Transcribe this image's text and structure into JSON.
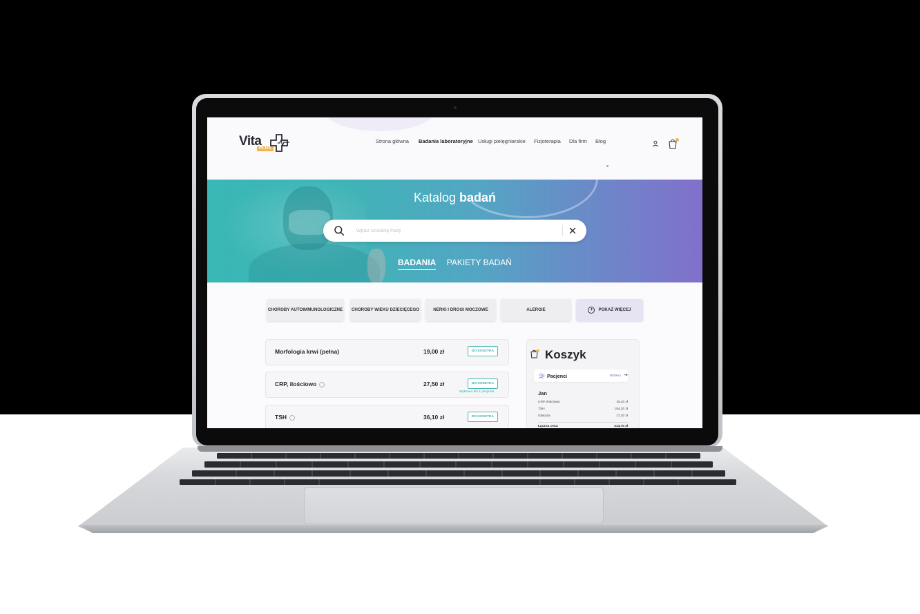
{
  "colors": {
    "accent_teal": "#39b8b5",
    "accent_purple": "#8270cb",
    "brand_yellow": "#f1b64a",
    "text_dark": "#25272e"
  },
  "logo": {
    "text": "Vita",
    "badge": "PLUS",
    "icon": "medical-cross-pulse-icon"
  },
  "nav": {
    "items": [
      {
        "label": "Strona główna"
      },
      {
        "label": "Badania laboratoryjne",
        "active": true
      },
      {
        "label": "Usługi pielęgniarskie"
      },
      {
        "label": "Fizjoterapia"
      },
      {
        "label": "Dla firm"
      },
      {
        "label": "Blog"
      }
    ],
    "icons": [
      "user-icon",
      "cart-icon"
    ]
  },
  "hero": {
    "title_light": "Katalog",
    "title_bold": "badań",
    "search": {
      "placeholder": "Wpisz szukaną frazę",
      "value": ""
    },
    "tabs": [
      {
        "label": "BADANIA",
        "active": true
      },
      {
        "label": "PAKIETY BADAŃ",
        "active": false
      }
    ]
  },
  "categories": [
    {
      "label": "CHOROBY AUTOIMMUNOLOGICZNE"
    },
    {
      "label": "CHOROBY WIEKU DZIECIĘCEGO"
    },
    {
      "label": "NERKI I DROGI MOCZOWE"
    },
    {
      "label": "ALERGIE"
    },
    {
      "label": "POKAŻ WIĘCEJ",
      "icon": "plus-circle-icon"
    }
  ],
  "tests": [
    {
      "name": "Morfologia krwi (pełna)",
      "price": "19,00 zł",
      "button": "DO KOSZYKA",
      "note": ""
    },
    {
      "name": "CRP, ilościowo",
      "price": "27,50 zł",
      "button": "DO KOSZYKA",
      "note": "Wybrano dla 1 pacjenta"
    },
    {
      "name": "TSH",
      "price": "36,10 zł",
      "button": "DO KOSZYKA",
      "note": ""
    }
  ],
  "cart": {
    "title": "Koszyk",
    "patients_label": "Pacjenci",
    "add_label": "DODAJ",
    "patient_name": "Jan",
    "rows": [
      {
        "name": "CRP, ilościowo",
        "price": "15,20 zł"
      },
      {
        "name": "TSH",
        "price": "154,20 zł"
      },
      {
        "name": "Glukoza",
        "price": "17,20 zł"
      }
    ],
    "total_label": "Łączna cena",
    "total_value": "213,70 zł"
  }
}
